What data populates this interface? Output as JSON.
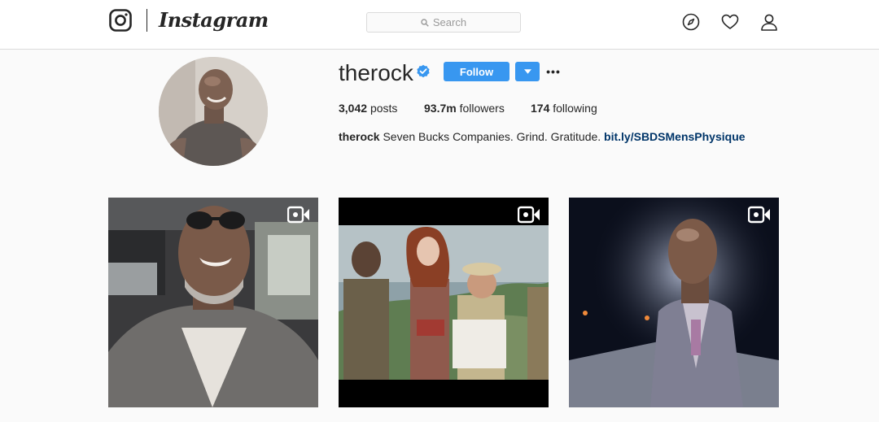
{
  "header": {
    "logo_icon": "instagram-glyph-icon",
    "wordmark": "Instagram",
    "search": {
      "placeholder": "Search",
      "icon": "search-icon"
    },
    "nav_icons": [
      "compass-icon",
      "heart-icon",
      "user-icon"
    ]
  },
  "profile": {
    "username": "therock",
    "verified_icon": "verified-badge-icon",
    "follow_label": "Follow",
    "dropdown_icon": "caret-down-icon",
    "more_label": "•••",
    "stats": {
      "posts_count": "3,042",
      "posts_label": "posts",
      "followers_count": "93.7m",
      "followers_label": "followers",
      "following_count": "174",
      "following_label": "following"
    },
    "bio": {
      "name": "therock",
      "text": "Seven Bucks Companies. Grind. Gratitude.",
      "link": "bit.ly/SBDSMensPhysique"
    }
  },
  "posts": [
    {
      "type": "video",
      "icon": "video-camera-icon"
    },
    {
      "type": "video",
      "icon": "video-camera-icon"
    },
    {
      "type": "video",
      "icon": "video-camera-icon"
    }
  ],
  "colors": {
    "accent": "#3897f0",
    "link": "#003569",
    "background": "#fafafa",
    "border": "#dbdbdb"
  }
}
